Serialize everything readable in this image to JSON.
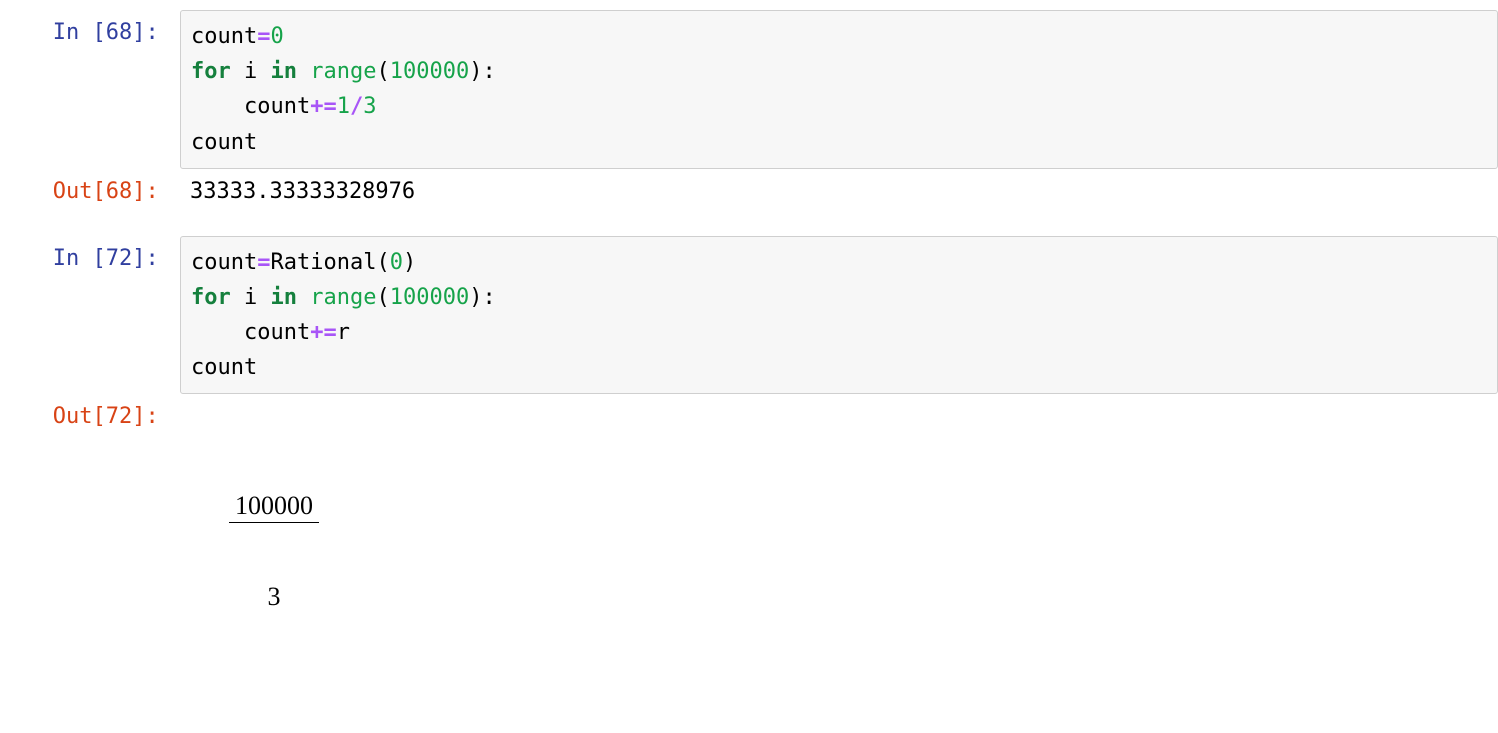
{
  "cells": [
    {
      "in_prompt": "In [68]: ",
      "out_prompt": "Out[68]: ",
      "code": {
        "l1_a": "count",
        "l1_op": "=",
        "l1_b": "0",
        "l2_kw1": "for",
        "l2_sp1": " ",
        "l2_var": "i",
        "l2_sp2": " ",
        "l2_kw2": "in",
        "l2_sp3": " ",
        "l2_fn": "range",
        "l2_p1": "(",
        "l2_arg": "100000",
        "l2_p2": ")",
        "l2_colon": ":",
        "l3_indent": "    ",
        "l3_a": "count",
        "l3_op": "+=",
        "l3_b": "1",
        "l3_div": "/",
        "l3_c": "3",
        "l4": "count"
      },
      "output_text": "33333.33333328976"
    },
    {
      "in_prompt": "In [72]: ",
      "out_prompt": "Out[72]: ",
      "code": {
        "l1_a": "count",
        "l1_op": "=",
        "l1_fn": "Rational",
        "l1_p1": "(",
        "l1_arg": "0",
        "l1_p2": ")",
        "l2_kw1": "for",
        "l2_sp1": " ",
        "l2_var": "i",
        "l2_sp2": " ",
        "l2_kw2": "in",
        "l2_sp3": " ",
        "l2_fn": "range",
        "l2_p1": "(",
        "l2_arg": "100000",
        "l2_p2": ")",
        "l2_colon": ":",
        "l3_indent": "    ",
        "l3_a": "count",
        "l3_op": "+=",
        "l3_b": "r",
        "l4": "count"
      },
      "output_frac": {
        "num": "100000",
        "den": "3"
      }
    }
  ]
}
